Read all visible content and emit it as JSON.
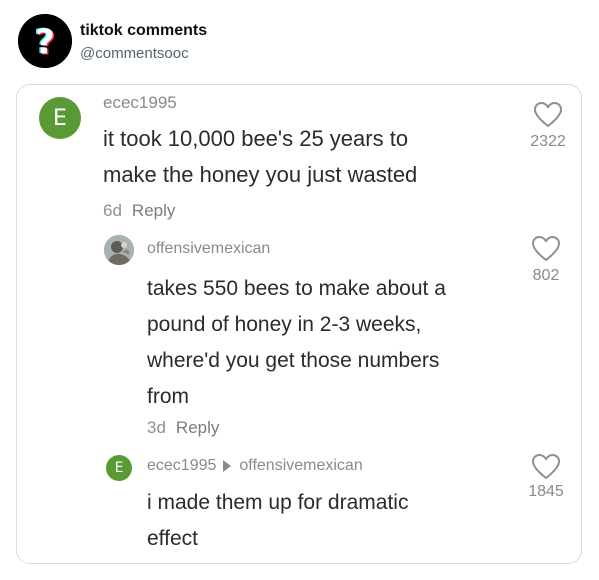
{
  "post": {
    "account_name": "tiktok comments",
    "account_handle": "@commentsooc"
  },
  "comments": [
    {
      "avatar_letter": "E",
      "avatar_color": "#5a9a35",
      "username": "ecec1995",
      "text_lines": [
        "it took 10,000 bee's 25 years to",
        "make the honey you just wasted"
      ],
      "age": "6d",
      "reply_label": "Reply",
      "likes": "2322"
    },
    {
      "avatar_icon": "profile-photo",
      "username": "offensivemexican",
      "text_lines": [
        "takes 550 bees to make about a",
        "pound of honey in 2-3 weeks,",
        "where'd you get those numbers",
        "from"
      ],
      "age": "3d",
      "reply_label": "Reply",
      "likes": "802"
    },
    {
      "avatar_letter": "E",
      "avatar_color": "#5a9a35",
      "username": "ecec1995",
      "reply_to": "offensivemexican",
      "text_lines": [
        "i made them up for dramatic",
        "effect"
      ],
      "likes": "1845"
    }
  ],
  "colors": {
    "meta_gray": "#8f8f8f",
    "text": "#2b2b2b",
    "border": "#d7dde2"
  }
}
